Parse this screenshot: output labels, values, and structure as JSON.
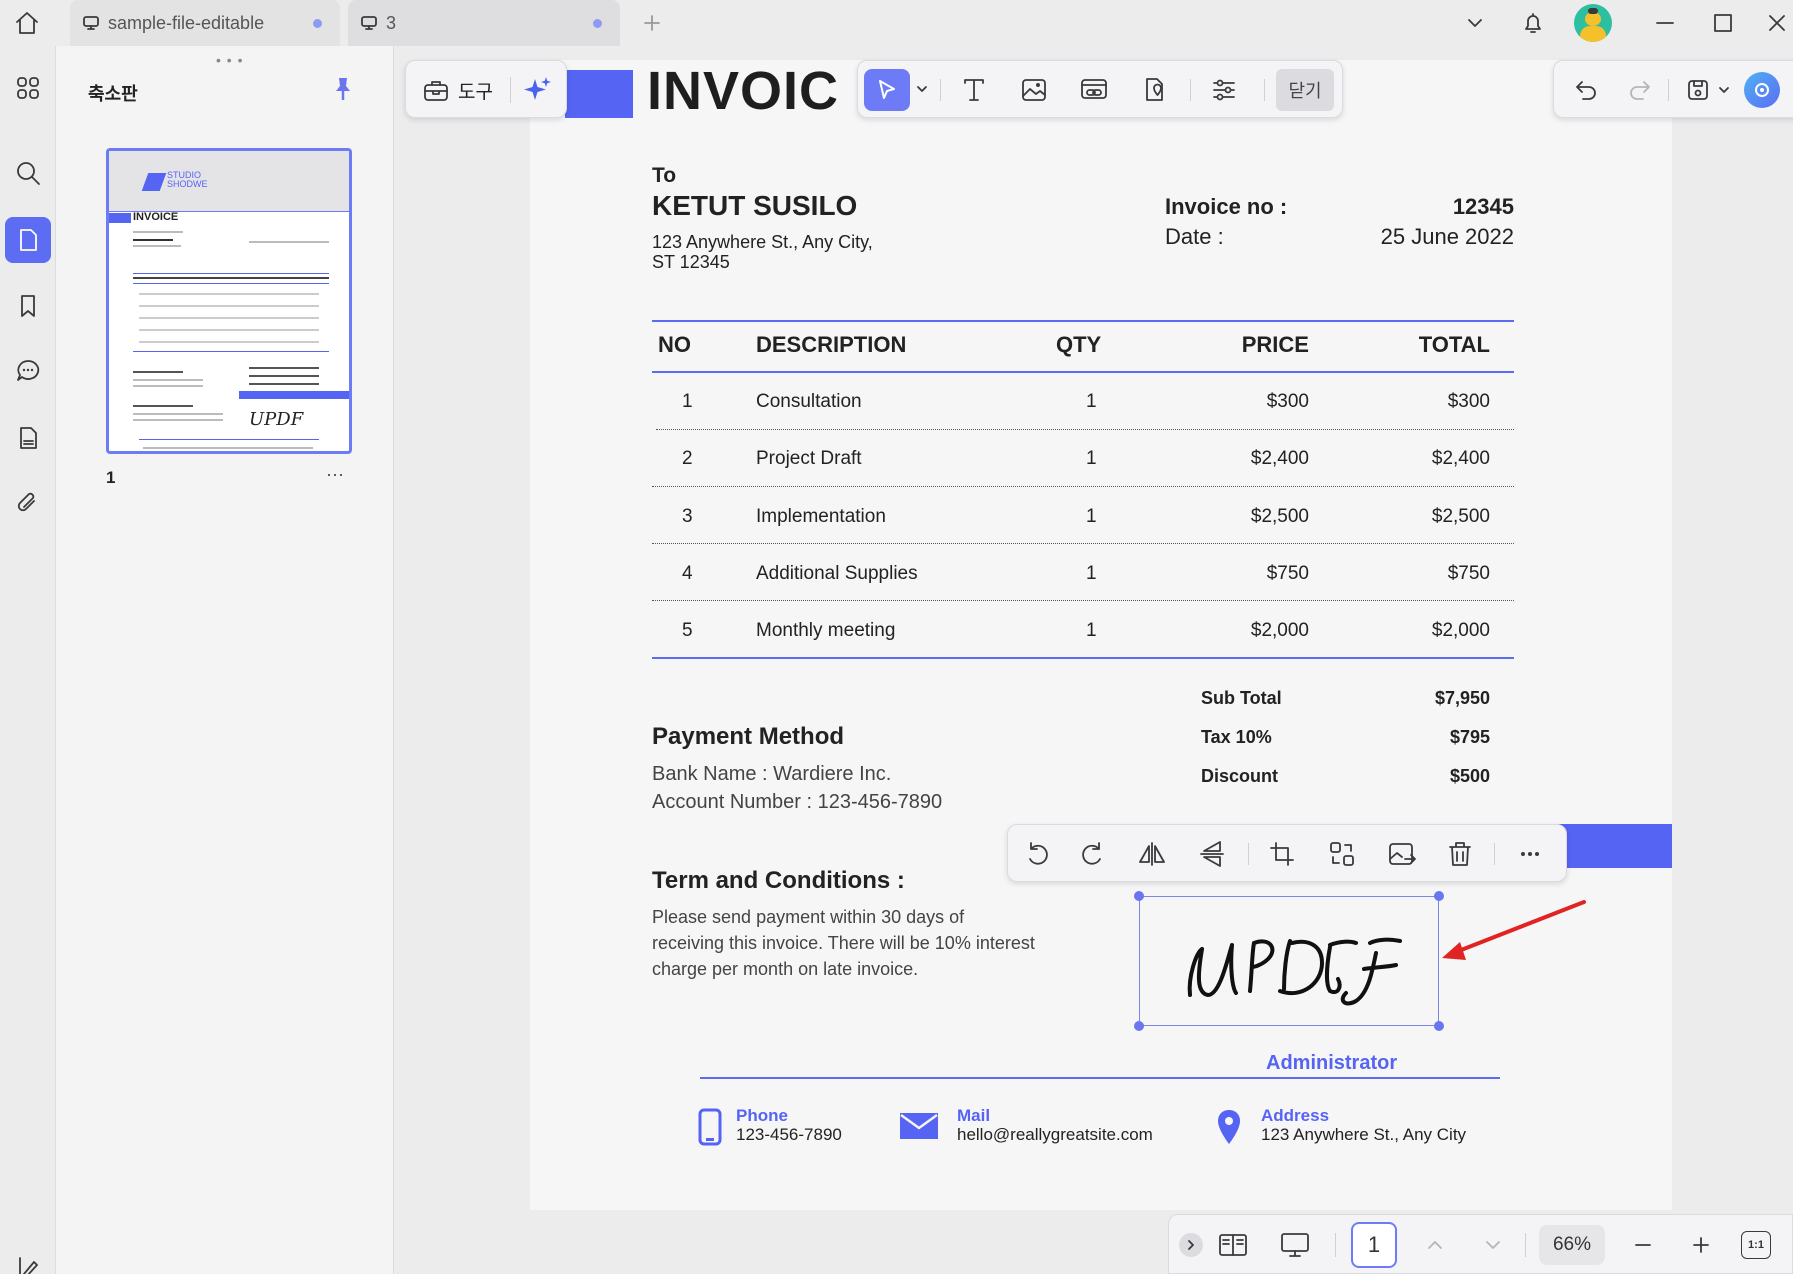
{
  "tabs": [
    {
      "label": "sample-file-editable",
      "icon": "monitor-icon"
    },
    {
      "label": "3",
      "icon": "monitor-icon"
    }
  ],
  "panel": {
    "title": "축소판",
    "page_label": "1",
    "more": "···"
  },
  "toolbar": {
    "tools_label": "도구",
    "close_label": "닫기"
  },
  "invoice": {
    "title": "INVOIC",
    "to_label": "To",
    "client_name": "KETUT SUSILO",
    "address_line1": "123 Anywhere St., Any City,",
    "address_line2": "ST 12345",
    "invoice_no_label": "Invoice no :",
    "invoice_no": "12345",
    "date_label": "Date :",
    "date": "25 June 2022",
    "headers": {
      "no": "NO",
      "description": "DESCRIPTION",
      "qty": "QTY",
      "price": "PRICE",
      "total": "TOTAL"
    },
    "items": [
      {
        "no": "1",
        "description": "Consultation",
        "qty": "1",
        "price": "$300",
        "total": "$300"
      },
      {
        "no": "2",
        "description": "Project Draft",
        "qty": "1",
        "price": "$2,400",
        "total": "$2,400"
      },
      {
        "no": "3",
        "description": "Implementation",
        "qty": "1",
        "price": "$2,500",
        "total": "$2,500"
      },
      {
        "no": "4",
        "description": "Additional Supplies",
        "qty": "1",
        "price": "$750",
        "total": "$750"
      },
      {
        "no": "5",
        "description": "Monthly meeting",
        "qty": "1",
        "price": "$2,000",
        "total": "$2,000"
      }
    ],
    "subtotal_label": "Sub Total",
    "subtotal": "$7,950",
    "tax_label": "Tax 10%",
    "tax": "$795",
    "discount_label": "Discount",
    "discount": "$500",
    "payment_title": "Payment Method",
    "bank_name": "Bank Name : Wardiere Inc.",
    "account_number": "Account Number : 123-456-7890",
    "terms_title": "Term and Conditions :",
    "terms_line1": "Please send payment within 30 days of",
    "terms_line2": "receiving this invoice. There will be 10% interest",
    "terms_line3": "charge per month on late invoice.",
    "signature_role": "Administrator",
    "contacts": [
      {
        "label": "Phone",
        "value": "123-456-7890",
        "icon": "phone-icon"
      },
      {
        "label": "Mail",
        "value": "hello@reallygreatsite.com",
        "icon": "mail-icon"
      },
      {
        "label": "Address",
        "value": "123 Anywhere St., Any City",
        "icon": "location-pin-icon"
      }
    ]
  },
  "thumbnail": {
    "brand_line1": "STUDIO",
    "brand_line2": "SHODWE",
    "title": "INVOICE"
  },
  "status": {
    "page_input": "1",
    "zoom": "66%",
    "fit_label": "1:1"
  },
  "colors": {
    "accent": "#5c6cf3",
    "invoice_blue": "#5664f4",
    "annotation_arrow": "#e02424"
  }
}
